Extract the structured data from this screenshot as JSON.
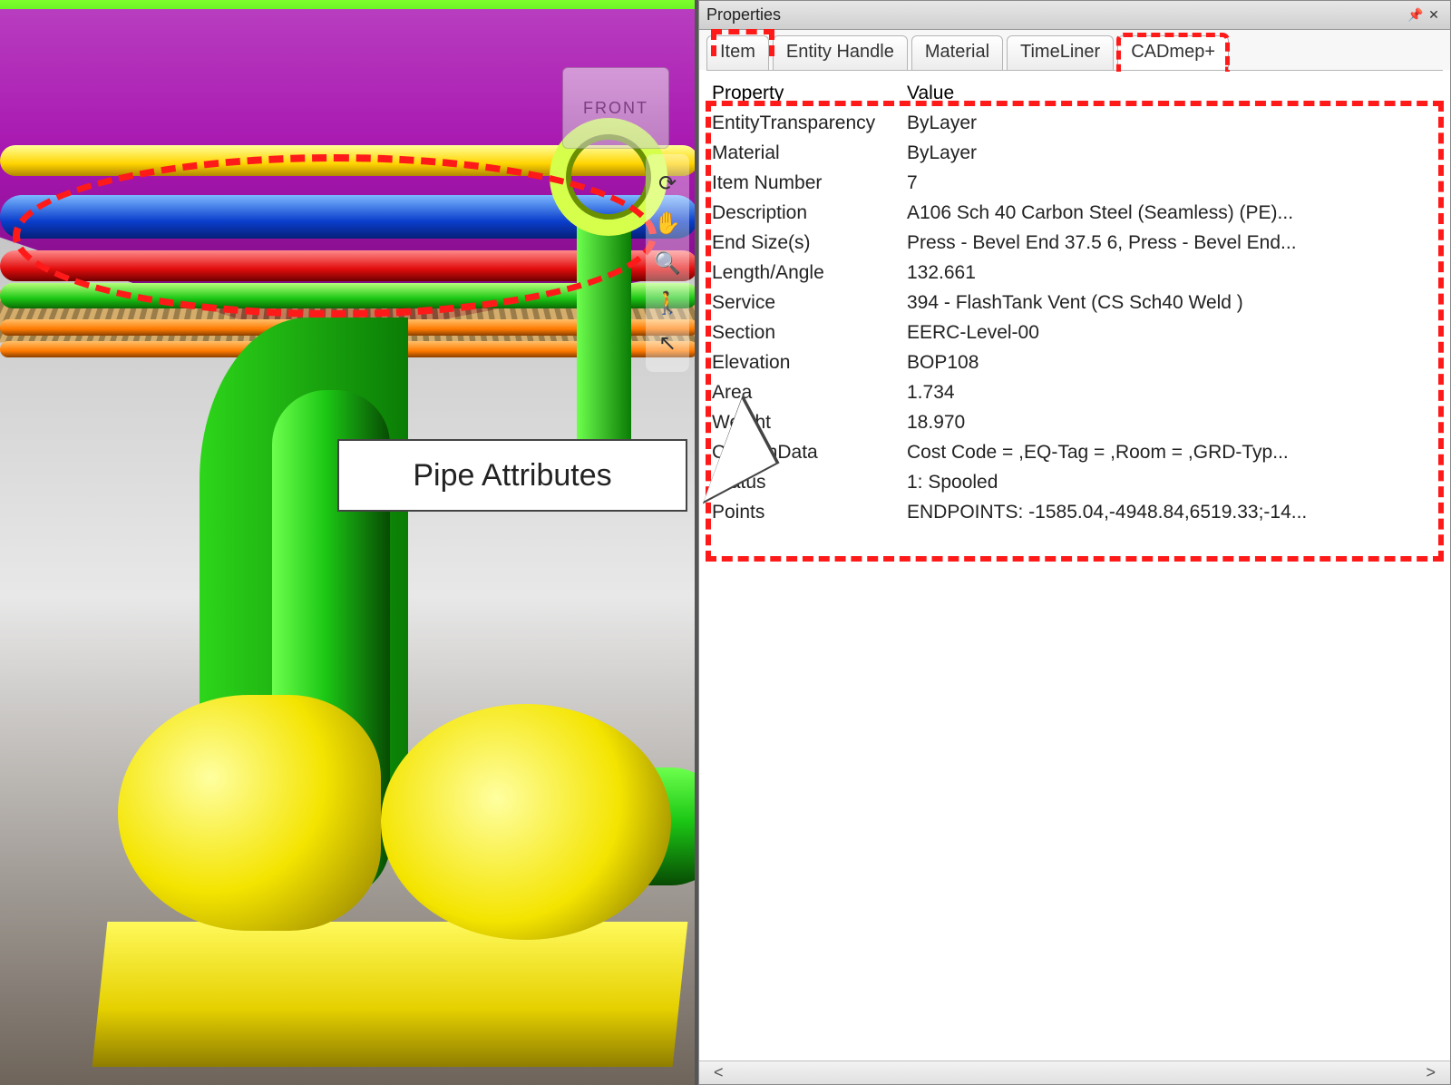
{
  "viewport": {
    "viewcube_label": "FRONT",
    "tools": [
      {
        "name": "orbit-icon",
        "glyph": "⟳"
      },
      {
        "name": "pan-icon",
        "glyph": "✋"
      },
      {
        "name": "zoom-icon",
        "glyph": "🔍"
      },
      {
        "name": "walk-icon",
        "glyph": "🚶"
      },
      {
        "name": "select-icon",
        "glyph": "↖"
      }
    ],
    "callout_label": "Pipe Attributes"
  },
  "panel": {
    "title": "Properties",
    "tabs": [
      {
        "label": "Item"
      },
      {
        "label": "Entity Handle"
      },
      {
        "label": "Material"
      },
      {
        "label": "TimeLiner"
      },
      {
        "label": "CADmep+",
        "active": true,
        "highlight": true
      }
    ],
    "header": {
      "col1": "Property",
      "col2": "Value"
    },
    "rows": [
      {
        "k": "EntityTransparency",
        "v": "ByLayer"
      },
      {
        "k": "Material",
        "v": "ByLayer"
      },
      {
        "k": "Item Number",
        "v": "7"
      },
      {
        "k": "Description",
        "v": "A106 Sch 40 Carbon Steel (Seamless) (PE)..."
      },
      {
        "k": "End Size(s)",
        "v": "Press - Bevel End 37.5 6, Press - Bevel End..."
      },
      {
        "k": "Length/Angle",
        "v": "132.661"
      },
      {
        "k": "Service",
        "v": "394 - FlashTank Vent (CS Sch40 Weld )"
      },
      {
        "k": "Section",
        "v": "EERC-Level-00"
      },
      {
        "k": "Elevation",
        "v": "BOP108"
      },
      {
        "k": "Area",
        "v": "1.734"
      },
      {
        "k": "Weight",
        "v": "18.970"
      },
      {
        "k": "CustomData",
        "v": "Cost Code = ,EQ-Tag = ,Room = ,GRD-Typ..."
      },
      {
        "k": "Status",
        "v": " 1: Spooled"
      },
      {
        "k": "Points",
        "v": "ENDPOINTS: -1585.04,-4948.84,6519.33;-14..."
      }
    ],
    "scroll": {
      "left": "<",
      "right": ">"
    }
  }
}
